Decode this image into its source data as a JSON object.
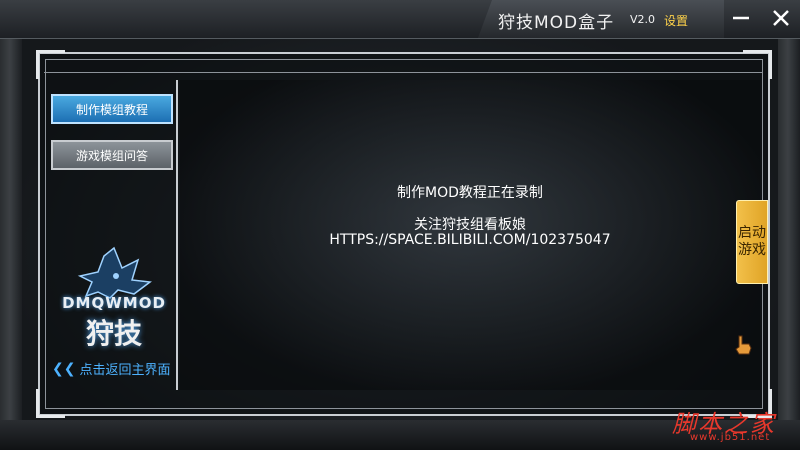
{
  "window": {
    "title": "狩技MOD盒子",
    "version": "V2.0",
    "settings_label": "设置"
  },
  "sidebar": {
    "items": [
      {
        "label": "制作模组教程",
        "active": true
      },
      {
        "label": "游戏模组问答",
        "active": false
      }
    ],
    "logo_text": "DMQWMOD",
    "logo_cn": "狩技",
    "back_label": "点击返回主界面"
  },
  "content": {
    "line1": "制作MOD教程正在录制",
    "line2": "关注狩技组看板娘",
    "line3": "HTTPS://SPACE.BILIBILI.COM/102375047"
  },
  "launch": {
    "label_top": "启动",
    "label_bottom": "游戏"
  },
  "watermark": {
    "text": "脚本之家",
    "url": "www.jb51.net"
  },
  "colors": {
    "accent_blue": "#1d6fb3",
    "link_blue": "#4db2ff",
    "gold": "#f2c04a",
    "settings_yellow": "#ffd34a"
  },
  "icons": [
    "minimize-icon",
    "close-icon",
    "double-chevron-left-icon",
    "hand-pointer-icon"
  ]
}
